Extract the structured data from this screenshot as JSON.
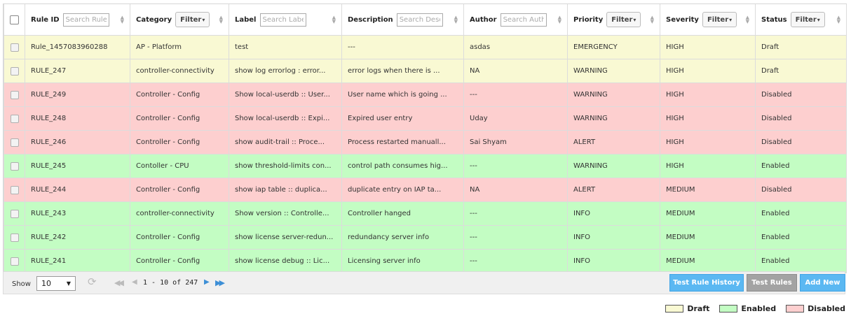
{
  "headers": {
    "rule_id": {
      "label": "Rule ID",
      "placeholder": "Search Rule ID"
    },
    "category": {
      "label": "Category",
      "filter": "Filter"
    },
    "label": {
      "label": "Label",
      "placeholder": "Search Label"
    },
    "description": {
      "label": "Description",
      "placeholder": "Search Description"
    },
    "author": {
      "label": "Author",
      "placeholder": "Search Author"
    },
    "priority": {
      "label": "Priority",
      "filter": "Filter"
    },
    "severity": {
      "label": "Severity",
      "filter": "Filter"
    },
    "status": {
      "label": "Status",
      "filter": "Filter"
    }
  },
  "rows": [
    {
      "state": "draft",
      "rule_id": "Rule_1457083960288",
      "category": "AP - Platform",
      "label": "test",
      "description": "---",
      "author": "asdas",
      "priority": "EMERGENCY",
      "severity": "HIGH",
      "status": "Draft"
    },
    {
      "state": "draft",
      "rule_id": "RULE_247",
      "category": "controller-connectivity",
      "label": "show log errorlog : error...",
      "description": "error logs when there is ...",
      "author": "NA",
      "priority": "WARNING",
      "severity": "HIGH",
      "status": "Draft"
    },
    {
      "state": "disabled",
      "rule_id": "RULE_249",
      "category": "Controller - Config",
      "label": "Show local-userdb :: User...",
      "description": "User name which is going ...",
      "author": "---",
      "priority": "WARNING",
      "severity": "HIGH",
      "status": "Disabled"
    },
    {
      "state": "disabled",
      "rule_id": "RULE_248",
      "category": "Controller - Config",
      "label": "Show local-userdb :: Expi...",
      "description": "Expired user entry",
      "author": "Uday",
      "priority": "WARNING",
      "severity": "HIGH",
      "status": "Disabled"
    },
    {
      "state": "disabled",
      "rule_id": "RULE_246",
      "category": "Controller - Config",
      "label": "show audit-trail :: Proce...",
      "description": "Process restarted manuall...",
      "author": "Sai Shyam",
      "priority": "ALERT",
      "severity": "HIGH",
      "status": "Disabled"
    },
    {
      "state": "enabled",
      "rule_id": "RULE_245",
      "category": "Contoller - CPU",
      "label": "show threshold-limits con...",
      "description": "control path consumes hig...",
      "author": "---",
      "priority": "WARNING",
      "severity": "HIGH",
      "status": "Enabled"
    },
    {
      "state": "disabled",
      "rule_id": "RULE_244",
      "category": "Controller - Config",
      "label": "show iap table :: duplica...",
      "description": "duplicate entry on IAP ta...",
      "author": "NA",
      "priority": "ALERT",
      "severity": "MEDIUM",
      "status": "Disabled"
    },
    {
      "state": "enabled",
      "rule_id": "RULE_243",
      "category": "controller-connectivity",
      "label": "Show version :: Controlle...",
      "description": "Controller hanged",
      "author": "---",
      "priority": "INFO",
      "severity": "MEDIUM",
      "status": "Enabled"
    },
    {
      "state": "enabled",
      "rule_id": "RULE_242",
      "category": "Controller - Config",
      "label": "show license server-redun...",
      "description": "redundancy server info",
      "author": "---",
      "priority": "INFO",
      "severity": "MEDIUM",
      "status": "Enabled"
    },
    {
      "state": "enabled",
      "rule_id": "RULE_241",
      "category": "Controller - Config",
      "label": "show license debug :: Lic...",
      "description": "Licensing server info",
      "author": "---",
      "priority": "INFO",
      "severity": "MEDIUM",
      "status": "Enabled"
    }
  ],
  "footer": {
    "show_label": "Show",
    "page_size": "10",
    "page_info": "1 - 10 of 247",
    "buttons": {
      "test_rule_history": "Test Rule History",
      "test_rules": "Test Rules",
      "add_new": "Add New"
    }
  },
  "legend": [
    {
      "label": "Draft",
      "color": "#f9f9d3"
    },
    {
      "label": "Enabled",
      "color": "#c3fdc3"
    },
    {
      "label": "Disabled",
      "color": "#fdcfcf"
    }
  ],
  "colors": {
    "draft": "#f9f9d3",
    "enabled": "#c3fdc3",
    "disabled": "#fdcfcf",
    "button_primary": "#5bb8f2",
    "button_disabled": "#a3a3a3",
    "pager_active": "#3d8fd6"
  },
  "icons": {
    "refresh": "refresh-icon",
    "first": "first-page-icon",
    "prev": "prev-page-icon",
    "next": "next-page-icon",
    "last": "last-page-icon"
  }
}
